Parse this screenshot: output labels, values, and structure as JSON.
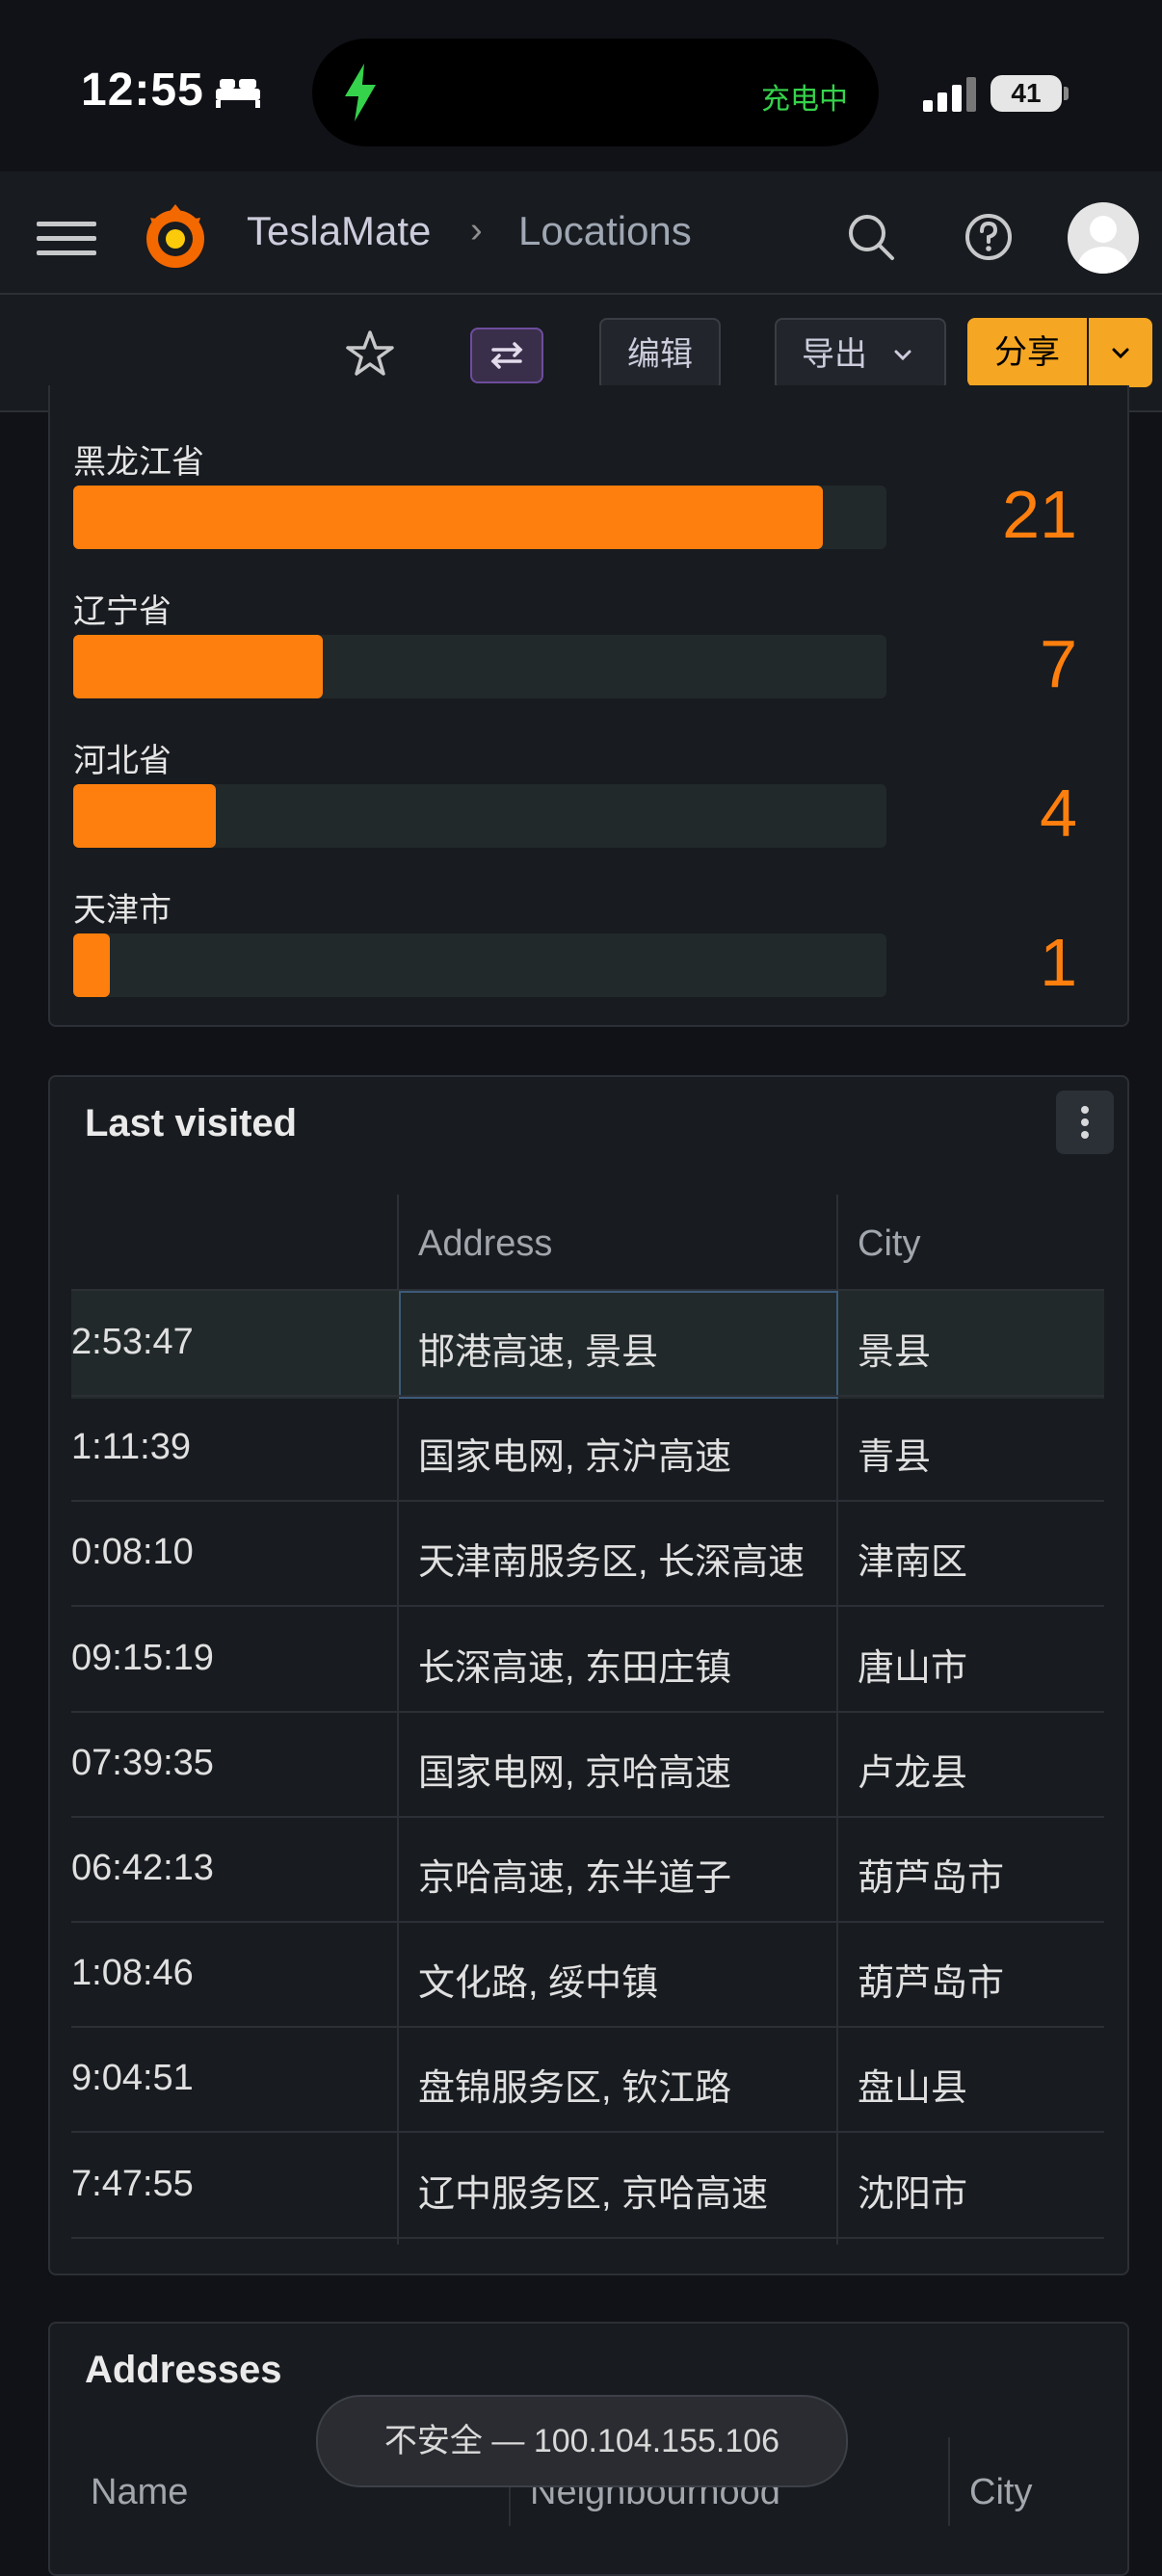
{
  "status_bar": {
    "time": "12:55",
    "charging_label": "充电中",
    "battery": "41"
  },
  "header": {
    "app": "TeslaMate",
    "separator": "›",
    "page": "Locations"
  },
  "toolbar": {
    "edit": "编辑",
    "export": "导出",
    "share": "分享"
  },
  "provinces": [
    {
      "name": "黑龙江省",
      "count": 21,
      "value": "21"
    },
    {
      "name": "辽宁省",
      "count": 7,
      "value": "7"
    },
    {
      "name": "河北省",
      "count": 4,
      "value": "4"
    },
    {
      "name": "天津市",
      "count": 1,
      "value": "1"
    }
  ],
  "last_visited": {
    "title": "Last visited",
    "columns": {
      "address": "Address",
      "city": "City"
    },
    "rows": [
      {
        "time": "2:53:47",
        "address": "邯港高速, 景县",
        "city": "景县"
      },
      {
        "time": "1:11:39",
        "address": "国家电网, 京沪高速",
        "city": "青县"
      },
      {
        "time": "0:08:10",
        "address": "天津南服务区, 长深高速",
        "city": "津南区"
      },
      {
        "time": "09:15:19",
        "address": "长深高速, 东田庄镇",
        "city": "唐山市"
      },
      {
        "time": "07:39:35",
        "address": "国家电网, 京哈高速",
        "city": "卢龙县"
      },
      {
        "time": "06:42:13",
        "address": "京哈高速, 东半道子",
        "city": "葫芦岛市"
      },
      {
        "time": "1:08:46",
        "address": "文化路, 绥中镇",
        "city": "葫芦岛市"
      },
      {
        "time": "9:04:51",
        "address": "盘锦服务区, 钦江路",
        "city": "盘山县"
      },
      {
        "time": "7:47:55",
        "address": "辽中服务区, 京哈高速",
        "city": "沈阳市"
      }
    ]
  },
  "addresses": {
    "title": "Addresses",
    "columns": {
      "name": "Name",
      "neighbourhood": "Neighbourhood",
      "city": "City"
    }
  },
  "browser": {
    "url_label": "不安全 — 100.104.155.106"
  },
  "colors": {
    "bar": "#ff7f0e",
    "share_button": "#f5a623",
    "background": "#111217",
    "panel": "#181b1f"
  },
  "icons": [
    "bed-icon",
    "charging-bolt-icon",
    "signal-icon",
    "menu-icon",
    "grafana-logo",
    "search-icon",
    "help-icon",
    "avatar",
    "star-icon",
    "switch-icon",
    "chevron-down-icon",
    "kebab-icon"
  ]
}
